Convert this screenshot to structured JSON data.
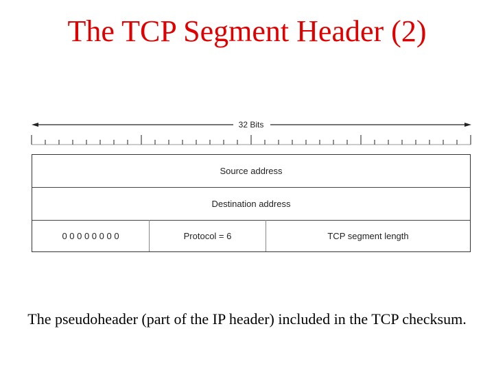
{
  "slide": {
    "title": "The TCP Segment Header (2)",
    "caption": "The pseudoheader (part of the IP header) included in the TCP checksum.",
    "title_color": "#e00000"
  },
  "diagram": {
    "ruler": {
      "label": "32 Bits",
      "bits": 32,
      "major_every": 8
    },
    "rows": [
      {
        "cells": [
          {
            "label": "Source address",
            "bits": 32
          }
        ]
      },
      {
        "cells": [
          {
            "label": "Destination address",
            "bits": 32
          }
        ]
      },
      {
        "cells": [
          {
            "label": "0 0 0 0 0 0 0 0",
            "bits": 8
          },
          {
            "label": "Protocol = 6",
            "bits": 8
          },
          {
            "label": "TCP segment length",
            "bits": 16
          }
        ]
      }
    ]
  }
}
